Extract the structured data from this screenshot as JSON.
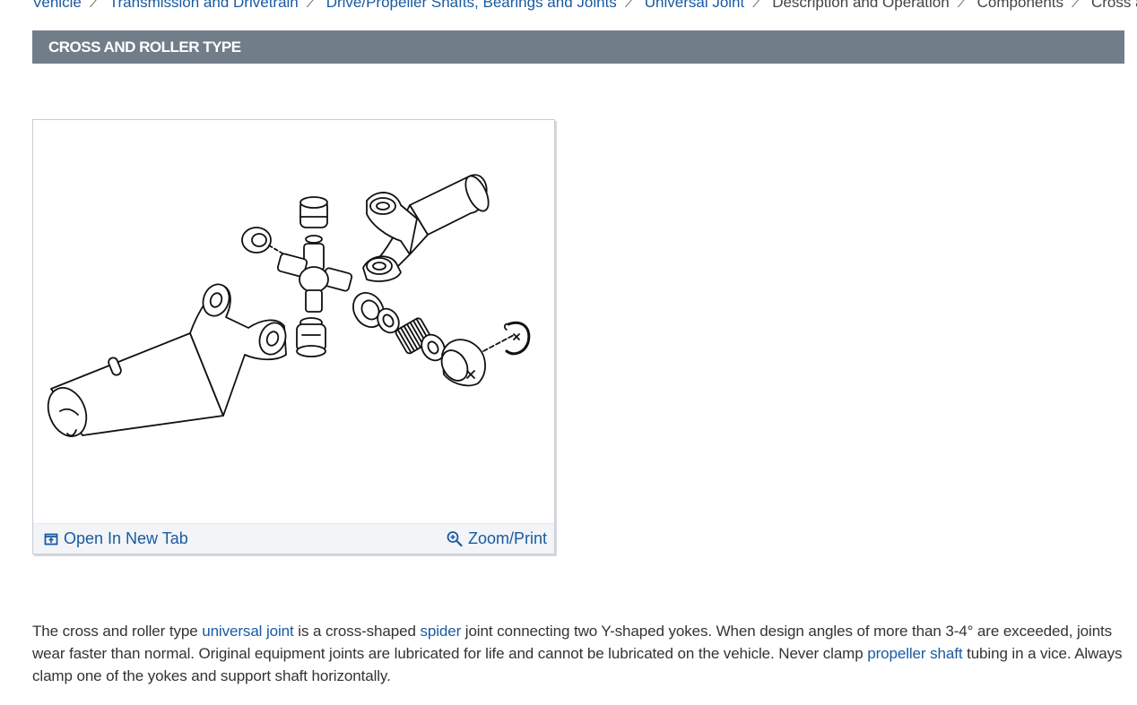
{
  "breadcrumb": {
    "items": [
      {
        "label": "Vehicle",
        "link": true
      },
      {
        "label": "Transmission and Drivetrain",
        "link": true
      },
      {
        "label": "Drive/Propeller Shafts, Bearings and Joints",
        "link": true
      },
      {
        "label": "Universal Joint",
        "link": true
      },
      {
        "label": "Description and Operation",
        "link": false
      },
      {
        "label": "Components",
        "link": false
      },
      {
        "label": "Cross and Roller Type",
        "link": false
      }
    ],
    "separator_icon": "chevron-right-icon"
  },
  "section": {
    "title": "CROSS AND ROLLER TYPE"
  },
  "figure": {
    "open_tab_label": "Open In New Tab",
    "open_tab_icon": "open-new-tab-icon",
    "zoom_label": "Zoom/Print",
    "zoom_icon": "zoom-in-icon"
  },
  "description": {
    "p1": "The cross and roller type ",
    "link1": "universal joint",
    "p2": " is a cross-shaped ",
    "link2": "spider",
    "p3": " joint connecting two Y-shaped yokes. When design angles of more than 3-4° are exceeded, joints wear faster than normal. Original equipment joints are lubricated for life and cannot be lubricated on the vehicle. Never clamp ",
    "link3": "propeller shaft",
    "p4": " tubing in a vice. Always clamp one of the yokes and support shaft horizontally."
  },
  "colors": {
    "link": "#1a5aa0",
    "header_bg": "#727d8a",
    "toolbar_bg": "#f2f4f7"
  }
}
